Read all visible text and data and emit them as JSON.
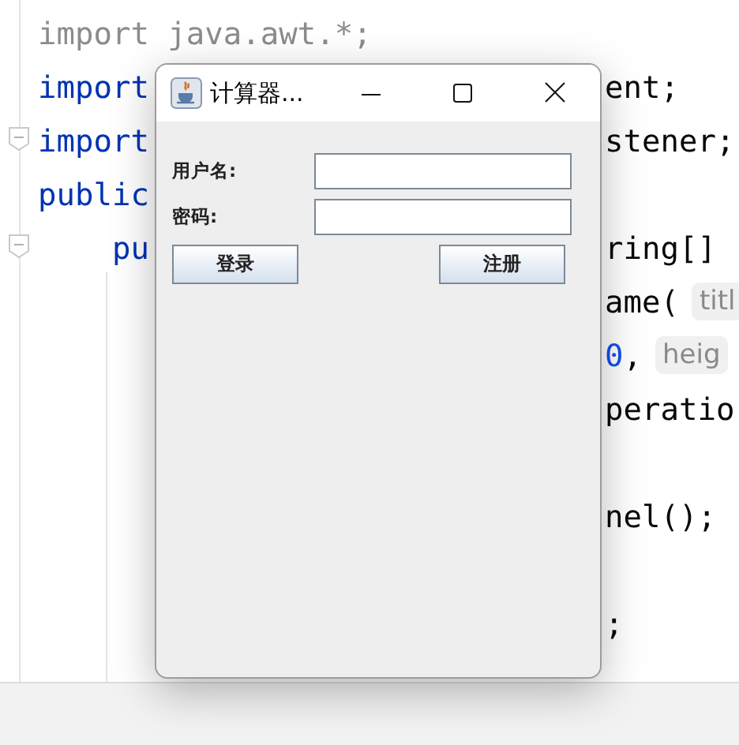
{
  "editor": {
    "lines": [
      {
        "left": [
          {
            "kind": "muted",
            "text": "import java.awt.*;"
          }
        ],
        "fold": false
      },
      {
        "left": [
          {
            "kind": "keyword",
            "text": "import"
          }
        ],
        "right": [
          {
            "kind": "plain",
            "text": "ent;"
          }
        ],
        "fold": false
      },
      {
        "left": [
          {
            "kind": "keyword",
            "text": "import"
          }
        ],
        "right": [
          {
            "kind": "plain",
            "text": "stener;"
          }
        ],
        "fold": true
      },
      {
        "left": [
          {
            "kind": "keyword",
            "text": "public"
          }
        ],
        "fold": false
      },
      {
        "left": [
          {
            "kind": "keyword",
            "text": "    pu"
          }
        ],
        "right": [
          {
            "kind": "plain",
            "text": "ring[]"
          }
        ],
        "fold": true
      },
      {
        "right": [
          {
            "kind": "plain",
            "text": "ame("
          },
          {
            "kind": "hint",
            "text": "titl"
          }
        ],
        "fold": false
      },
      {
        "right": [
          {
            "kind": "number",
            "text": "0"
          },
          {
            "kind": "plain",
            "text": ","
          },
          {
            "kind": "hint",
            "text": "heig"
          }
        ],
        "fold": false
      },
      {
        "right": [
          {
            "kind": "plain",
            "text": "peratio"
          }
        ],
        "fold": false
      },
      {
        "fold": false
      },
      {
        "right": [
          {
            "kind": "plain",
            "text": "nel();"
          }
        ],
        "fold": false
      },
      {
        "fold": false
      },
      {
        "right": [
          {
            "kind": "plain",
            "text": ";"
          }
        ],
        "fold": false
      }
    ]
  },
  "dialog": {
    "title": "计算器...",
    "fields": [
      {
        "label": "用户名:"
      },
      {
        "label": "密码:"
      }
    ],
    "buttons": [
      "登录",
      "注册"
    ]
  }
}
